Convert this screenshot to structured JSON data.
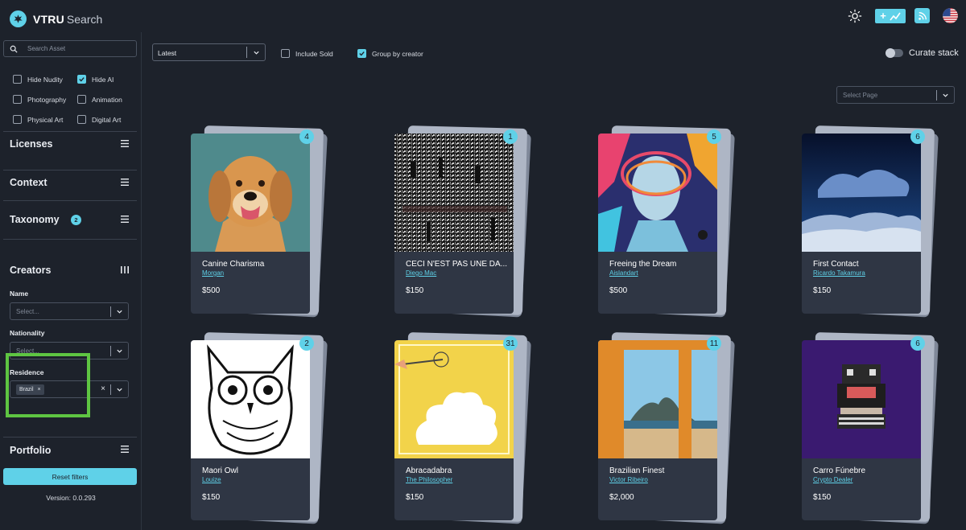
{
  "brand": {
    "name_bold": "VTRU",
    "name_light": "Search"
  },
  "topbar": {
    "add_label": "+",
    "icons": [
      "sun-icon",
      "add-collection-icon",
      "rss-icon",
      "us-flag-icon"
    ]
  },
  "sidebar": {
    "search_placeholder": "Search Asset",
    "filters": [
      {
        "label": "Hide Nudity",
        "checked": false
      },
      {
        "label": "Hide AI",
        "checked": true
      },
      {
        "label": "Photography",
        "checked": false
      },
      {
        "label": "Animation",
        "checked": false
      },
      {
        "label": "Physical Art",
        "checked": false
      },
      {
        "label": "Digital Art",
        "checked": false
      }
    ],
    "sections": {
      "licenses": "Licenses",
      "context": "Context",
      "taxonomy": "Taxonomy",
      "taxonomy_badge": "2",
      "creators": "Creators",
      "portfolio": "Portfolio"
    },
    "creators": {
      "name_label": "Name",
      "name_placeholder": "Select...",
      "nationality_label": "Nationality",
      "nationality_placeholder": "Select...",
      "residence_label": "Residence",
      "residence_tag": "Brazil",
      "tag_remove": "×",
      "clear": "×"
    },
    "reset_label": "Reset filters",
    "version": "Version: 0.0.293"
  },
  "toolbar": {
    "sort_value": "Latest",
    "include_sold": {
      "label": "Include Sold",
      "checked": false
    },
    "group_by_creator": {
      "label": "Group by creator",
      "checked": true
    },
    "curate_label": "Curate stack",
    "curate_on": false,
    "page_placeholder": "Select Page"
  },
  "cards": [
    {
      "title": "Canine Charisma",
      "artist": "Morgan",
      "price": "$500",
      "count": "4"
    },
    {
      "title": "CECI N'EST PAS UNE DA...",
      "artist": "Diego Mac",
      "price": "$150",
      "count": "1"
    },
    {
      "title": "Freeing the Dream",
      "artist": "Aislandart",
      "price": "$500",
      "count": "5"
    },
    {
      "title": "First Contact",
      "artist": "Ricardo Takamura",
      "price": "$150",
      "count": "6"
    },
    {
      "title": "Maori Owl",
      "artist": "Louize",
      "price": "$150",
      "count": "2"
    },
    {
      "title": "Abracadabra",
      "artist": "The Philosopher",
      "price": "$150",
      "count": "31"
    },
    {
      "title": "Brazilian Finest",
      "artist": "Victor Ribeiro",
      "price": "$2,000",
      "count": "11"
    },
    {
      "title": "Carro Fúnebre",
      "artist": "Crypto Dealer",
      "price": "$150",
      "count": "6"
    }
  ],
  "colors": {
    "accent": "#5fd1e8",
    "background": "#1d222b",
    "card": "#2f3644",
    "highlight": "#5ec542"
  }
}
